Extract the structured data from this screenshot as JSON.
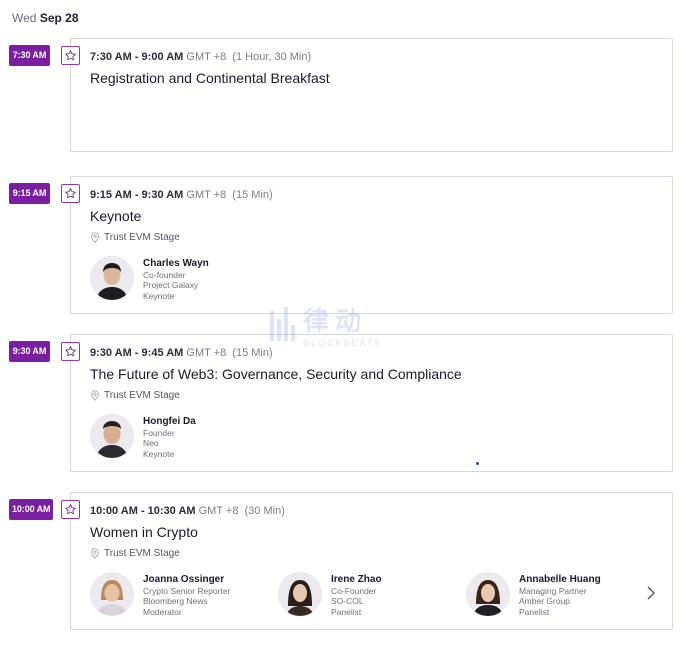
{
  "date": {
    "weekday": "Wed",
    "day": "Sep 28"
  },
  "watermark": {
    "logo": "律动",
    "sub": "BLOCKBEATS"
  },
  "sessions": [
    {
      "badge": "7:30 AM",
      "time_span": "7:30 AM - 9:00 AM",
      "tz": "GMT +8",
      "duration": "(1 Hour, 30 Min)",
      "title": "Registration and Continental Breakfast",
      "location": "",
      "speakers": []
    },
    {
      "badge": "9:15 AM",
      "time_span": "9:15 AM - 9:30 AM",
      "tz": "GMT +8",
      "duration": "(15 Min)",
      "title": "Keynote",
      "location": "Trust EVM Stage",
      "speakers": [
        {
          "name": "Charles Wayn",
          "role": "Co-founder",
          "org": "Project Galaxy",
          "type": "Keynote"
        }
      ]
    },
    {
      "badge": "9:30 AM",
      "time_span": "9:30 AM - 9:45 AM",
      "tz": "GMT +8",
      "duration": "(15 Min)",
      "title": "The Future of Web3: Governance, Security and Compliance",
      "location": "Trust EVM Stage",
      "speakers": [
        {
          "name": "Hongfei Da",
          "role": "Founder",
          "org": "Neo",
          "type": "Keynote"
        }
      ]
    },
    {
      "badge": "10:00 AM",
      "time_span": "10:00 AM - 10:30 AM",
      "tz": "GMT +8",
      "duration": "(30 Min)",
      "title": "Women in Crypto",
      "location": "Trust EVM Stage",
      "speakers": [
        {
          "name": "Joanna Ossinger",
          "role": "Crypto Senior Reporter",
          "org": "Bloomberg News",
          "type": "Moderator"
        },
        {
          "name": "Irene Zhao",
          "role": "Co-Founder",
          "org": "SO-COL",
          "type": "Panelist"
        },
        {
          "name": "Annabelle Huang",
          "role": "Managing Partner",
          "org": "Amber Group",
          "type": "Panelist"
        }
      ]
    }
  ],
  "colors": {
    "badge": "#7a1fa2",
    "border": "#d6d6de",
    "accent": "#8a3bb0"
  },
  "icons": {
    "favorite": "star-icon",
    "location": "map-pin-icon",
    "next": "chevron-right-icon"
  }
}
